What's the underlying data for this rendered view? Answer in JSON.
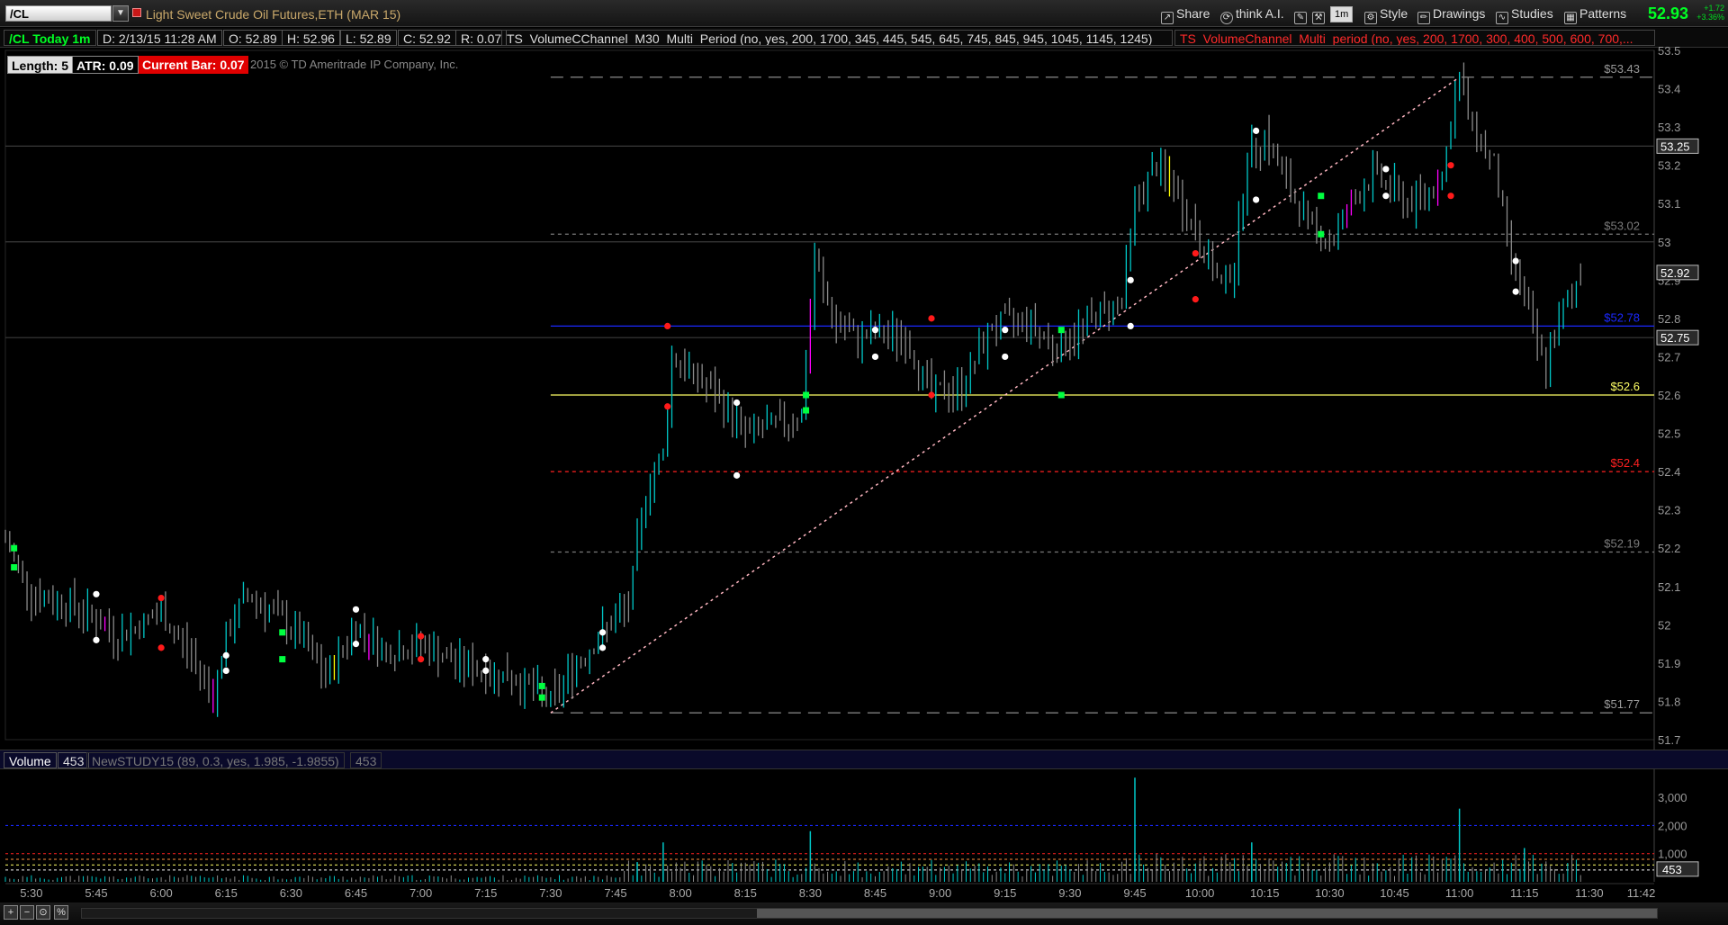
{
  "window": {
    "symbol": "/CL",
    "instrument_name": "Light Sweet Crude Oil Futures,ETH (MAR 15)",
    "toolbar": {
      "share": "Share",
      "think_ai": "think A.I.",
      "timeframe": "1m",
      "style": "Style",
      "drawings": "Drawings",
      "studies": "Studies",
      "patterns": "Patterns"
    },
    "last_price": "52.93",
    "change_abs": "+1.72",
    "change_pct": "+3.36%"
  },
  "quote_bar": {
    "chart_label": "/CL Today 1m",
    "date": "D: 2/13/15 11:28 AM",
    "open": "O: 52.89",
    "high": "H: 52.96",
    "low": "L: 52.89",
    "close": "C: 52.92",
    "range": "R: 0.07",
    "study1": "TS_VolumeCChannel_M30_Multi_Period (no, yes, 200, 1700, 345, 445, 545, 645, 745, 845, 945, 1045, 1145, 1245)",
    "study2": "TS_VolumeChannel_Multi_period (no, yes, 200, 1700, 300, 400, 500, 600, 700,..."
  },
  "studies_row": {
    "length": "Length: 5",
    "atr": "ATR: 0.09",
    "current_bar": "Current Bar: 0.07",
    "copyright": "2015 © TD Ameritrade IP Company, Inc."
  },
  "volume_header": {
    "label": "Volume",
    "value": "453",
    "study": "NewSTUDY15 (89, 0.3, yes, 1.985, -1.9855)",
    "study_value": "453"
  },
  "colors": {
    "up": "#00c8c8",
    "down": "#8a8a8a",
    "green_dot": "#00ff40",
    "red_dot": "#ff1a1a",
    "white_dot": "#ffffff",
    "magenta_bar": "#ff00ff",
    "yellow_bar": "#ffff00",
    "level_yellow": "#ffff66",
    "level_blue": "#1a28ff",
    "level_red": "#ff2020",
    "trend_pink": "#ffb6c1"
  },
  "chart_data": {
    "type": "candlestick",
    "y_ticks": [
      "53.5",
      "53.4",
      "53.3",
      "53.2",
      "53.1",
      "53",
      "52.9",
      "52.8",
      "52.7",
      "52.6",
      "52.5",
      "52.4",
      "52.3",
      "52.2",
      "52.1",
      "52",
      "51.9",
      "51.8",
      "51.7"
    ],
    "ylim": [
      51.7,
      53.5
    ],
    "x_ticks": [
      "5:30",
      "5:45",
      "6:00",
      "6:15",
      "6:30",
      "6:45",
      "7:00",
      "7:15",
      "7:30",
      "7:45",
      "8:00",
      "8:15",
      "8:30",
      "8:45",
      "9:00",
      "9:15",
      "9:30",
      "9:45",
      "10:00",
      "10:15",
      "10:30",
      "10:45",
      "11:00",
      "11:15",
      "11:30",
      "11:42"
    ],
    "levels": [
      {
        "label": "$53.43",
        "value": 53.43,
        "color": "#9a9a9a",
        "style": "long-dash"
      },
      {
        "label": "$53.02",
        "value": 53.02,
        "color": "#7a7a7a",
        "style": "short-dash"
      },
      {
        "label": "$52.78",
        "value": 52.78,
        "color": "#1a28ff",
        "style": "solid"
      },
      {
        "label": "$52.6",
        "value": 52.6,
        "color": "#ffff66",
        "style": "solid"
      },
      {
        "label": "$52.4",
        "value": 52.4,
        "color": "#ff2020",
        "style": "short-dash"
      },
      {
        "label": "$52.19",
        "value": 52.19,
        "color": "#7a7a7a",
        "style": "short-dash"
      },
      {
        "label": "$51.77",
        "value": 51.77,
        "color": "#9a9a9a",
        "style": "long-dash"
      }
    ],
    "price_bubbles": [
      {
        "label": "53.25",
        "value": 53.25
      },
      {
        "label": "52.92",
        "value": 52.92
      },
      {
        "label": "52.75",
        "value": 52.75
      }
    ],
    "horizontal_grey": [
      53.25,
      53.0,
      52.75
    ],
    "trend_line": {
      "from": [
        "7:30",
        51.77
      ],
      "to": [
        "11:00",
        53.43
      ]
    },
    "path": [
      [
        "5:24",
        52.22
      ],
      [
        "5:30",
        52.08
      ],
      [
        "5:40",
        52.05
      ],
      [
        "5:50",
        51.97
      ],
      [
        "6:00",
        52.03
      ],
      [
        "6:08",
        51.9
      ],
      [
        "6:12",
        51.82
      ],
      [
        "6:16",
        52.0
      ],
      [
        "6:20",
        52.08
      ],
      [
        "6:27",
        52.02
      ],
      [
        "6:32",
        51.97
      ],
      [
        "6:38",
        51.86
      ],
      [
        "6:45",
        52.0
      ],
      [
        "6:52",
        51.93
      ],
      [
        "7:00",
        51.95
      ],
      [
        "7:08",
        51.9
      ],
      [
        "7:15",
        51.88
      ],
      [
        "7:22",
        51.86
      ],
      [
        "7:30",
        51.8
      ],
      [
        "7:36",
        51.9
      ],
      [
        "7:42",
        51.98
      ],
      [
        "7:48",
        52.05
      ],
      [
        "7:52",
        52.35
      ],
      [
        "7:56",
        52.45
      ],
      [
        "7:58",
        52.7
      ],
      [
        "8:03",
        52.65
      ],
      [
        "8:08",
        52.6
      ],
      [
        "8:15",
        52.5
      ],
      [
        "8:22",
        52.52
      ],
      [
        "8:28",
        52.55
      ],
      [
        "8:31",
        52.95
      ],
      [
        "8:35",
        52.8
      ],
      [
        "8:40",
        52.75
      ],
      [
        "8:45",
        52.76
      ],
      [
        "8:52",
        52.75
      ],
      [
        "8:58",
        52.6
      ],
      [
        "9:05",
        52.62
      ],
      [
        "9:12",
        52.78
      ],
      [
        "9:20",
        52.8
      ],
      [
        "9:27",
        52.72
      ],
      [
        "9:35",
        52.8
      ],
      [
        "9:42",
        52.85
      ],
      [
        "9:45",
        53.1
      ],
      [
        "9:50",
        53.2
      ],
      [
        "9:55",
        53.12
      ],
      [
        "10:00",
        53.0
      ],
      [
        "10:05",
        52.88
      ],
      [
        "10:08",
        52.95
      ],
      [
        "10:11",
        53.22
      ],
      [
        "10:15",
        53.28
      ],
      [
        "10:20",
        53.15
      ],
      [
        "10:25",
        53.05
      ],
      [
        "10:30",
        53.0
      ],
      [
        "10:35",
        53.1
      ],
      [
        "10:40",
        53.18
      ],
      [
        "10:48",
        53.1
      ],
      [
        "10:52",
        53.12
      ],
      [
        "10:56",
        53.18
      ],
      [
        "11:00",
        53.43
      ],
      [
        "11:03",
        53.3
      ],
      [
        "11:08",
        53.2
      ],
      [
        "11:11",
        53.0
      ],
      [
        "11:15",
        52.85
      ],
      [
        "11:18",
        52.72
      ],
      [
        "11:20",
        52.68
      ],
      [
        "11:24",
        52.82
      ],
      [
        "11:28",
        52.92
      ]
    ],
    "dots": [
      {
        "t": "5:26",
        "v": 52.2,
        "c": "green"
      },
      {
        "t": "5:26",
        "v": 52.15,
        "c": "green"
      },
      {
        "t": "5:45",
        "v": 52.08,
        "c": "white"
      },
      {
        "t": "5:45",
        "v": 51.96,
        "c": "white"
      },
      {
        "t": "6:00",
        "v": 52.07,
        "c": "red"
      },
      {
        "t": "6:00",
        "v": 51.94,
        "c": "red"
      },
      {
        "t": "6:15",
        "v": 51.92,
        "c": "white"
      },
      {
        "t": "6:15",
        "v": 51.88,
        "c": "white"
      },
      {
        "t": "6:28",
        "v": 51.98,
        "c": "green"
      },
      {
        "t": "6:28",
        "v": 51.91,
        "c": "green"
      },
      {
        "t": "6:45",
        "v": 52.04,
        "c": "white"
      },
      {
        "t": "6:45",
        "v": 51.95,
        "c": "white"
      },
      {
        "t": "7:00",
        "v": 51.97,
        "c": "red"
      },
      {
        "t": "7:00",
        "v": 51.91,
        "c": "red"
      },
      {
        "t": "7:15",
        "v": 51.91,
        "c": "white"
      },
      {
        "t": "7:15",
        "v": 51.88,
        "c": "white"
      },
      {
        "t": "7:28",
        "v": 51.84,
        "c": "green"
      },
      {
        "t": "7:28",
        "v": 51.81,
        "c": "green"
      },
      {
        "t": "7:42",
        "v": 51.98,
        "c": "white"
      },
      {
        "t": "7:42",
        "v": 51.94,
        "c": "white"
      },
      {
        "t": "7:57",
        "v": 52.78,
        "c": "red"
      },
      {
        "t": "7:57",
        "v": 52.57,
        "c": "red"
      },
      {
        "t": "8:13",
        "v": 52.58,
        "c": "white"
      },
      {
        "t": "8:13",
        "v": 52.39,
        "c": "white"
      },
      {
        "t": "8:29",
        "v": 52.6,
        "c": "green"
      },
      {
        "t": "8:29",
        "v": 52.56,
        "c": "green"
      },
      {
        "t": "8:45",
        "v": 52.77,
        "c": "white"
      },
      {
        "t": "8:45",
        "v": 52.7,
        "c": "white"
      },
      {
        "t": "8:58",
        "v": 52.8,
        "c": "red"
      },
      {
        "t": "8:58",
        "v": 52.6,
        "c": "red"
      },
      {
        "t": "9:15",
        "v": 52.77,
        "c": "white"
      },
      {
        "t": "9:15",
        "v": 52.7,
        "c": "white"
      },
      {
        "t": "9:28",
        "v": 52.77,
        "c": "green"
      },
      {
        "t": "9:28",
        "v": 52.6,
        "c": "green"
      },
      {
        "t": "9:44",
        "v": 52.9,
        "c": "white"
      },
      {
        "t": "9:44",
        "v": 52.78,
        "c": "white"
      },
      {
        "t": "9:59",
        "v": 52.97,
        "c": "red"
      },
      {
        "t": "9:59",
        "v": 52.85,
        "c": "red"
      },
      {
        "t": "10:13",
        "v": 53.29,
        "c": "white"
      },
      {
        "t": "10:13",
        "v": 53.11,
        "c": "white"
      },
      {
        "t": "10:28",
        "v": 53.12,
        "c": "green"
      },
      {
        "t": "10:28",
        "v": 53.02,
        "c": "green"
      },
      {
        "t": "10:43",
        "v": 53.19,
        "c": "white"
      },
      {
        "t": "10:43",
        "v": 53.12,
        "c": "white"
      },
      {
        "t": "10:58",
        "v": 53.2,
        "c": "red"
      },
      {
        "t": "10:58",
        "v": 53.12,
        "c": "red"
      },
      {
        "t": "11:13",
        "v": 52.95,
        "c": "white"
      },
      {
        "t": "11:13",
        "v": 52.87,
        "c": "white"
      }
    ],
    "volume": {
      "y_ticks": [
        "3,000",
        "2,000",
        "1,000"
      ],
      "ylim": [
        0,
        3900
      ],
      "current_label": "453",
      "spikes": [
        [
          "7:50",
          700
        ],
        [
          "7:56",
          1400
        ],
        [
          "8:30",
          1800
        ],
        [
          "9:45",
          3700
        ],
        [
          "10:12",
          1400
        ],
        [
          "11:00",
          2600
        ],
        [
          "11:15",
          1200
        ]
      ]
    }
  }
}
